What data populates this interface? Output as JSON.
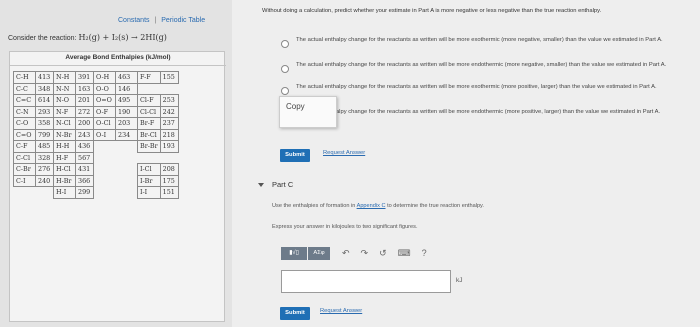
{
  "left": {
    "links": {
      "constants": "Constants",
      "separator": "|",
      "periodic": "Periodic Table"
    },
    "reaction": {
      "prefix": "Consider the reaction:",
      "equation": "H₂(g) + I₂(s) → 2HI(g)"
    },
    "table": {
      "title": "Average Bond Enthalpies (kJ/mol)",
      "rows": [
        [
          "C-H",
          "413",
          "N-H",
          "391",
          "O-H",
          "463",
          "F-F",
          "155"
        ],
        [
          "C-C",
          "348",
          "N-N",
          "163",
          "O-O",
          "146",
          "",
          ""
        ],
        [
          "C=C",
          "614",
          "N-O",
          "201",
          "O=O",
          "495",
          "Cl-F",
          "253"
        ],
        [
          "C-N",
          "293",
          "N-F",
          "272",
          "O-F",
          "190",
          "Cl-Cl",
          "242"
        ],
        [
          "C-O",
          "358",
          "N-Cl",
          "200",
          "O-Cl",
          "203",
          "Br-F",
          "237"
        ],
        [
          "C=O",
          "799",
          "N-Br",
          "243",
          "O-I",
          "234",
          "Br-Cl",
          "218"
        ],
        [
          "C-F",
          "485",
          "H-H",
          "436",
          "",
          "",
          "Br-Br",
          "193"
        ],
        [
          "C-Cl",
          "328",
          "H-F",
          "567",
          "",
          "",
          "",
          ""
        ],
        [
          "C-Br",
          "276",
          "H-Cl",
          "431",
          "",
          "",
          "I-Cl",
          "208"
        ],
        [
          "C-I",
          "240",
          "H-Br",
          "366",
          "",
          "",
          "I-Br",
          "175"
        ],
        [
          "",
          "",
          "H-I",
          "299",
          "",
          "",
          "I-I",
          "151"
        ]
      ]
    }
  },
  "right": {
    "instruction": "Without doing a calculation, predict whether your estimate in Part A is more negative or less negative than the true reaction enthalpy.",
    "options": [
      "The actual enthalpy change for the reactants as written will be more exothermic (more negative, smaller) than the value we estimated in Part A.",
      "The actual enthalpy change for the reactants as written will be more endothermic (more negative, smaller) than the value we estimated in Part A.",
      "The actual enthalpy change for the reactants as written will be more exothermic (more positive, larger) than the value we estimated in Part A.",
      "The actual enthalpy change for the reactants as written will be more endothermic (more positive, larger) than the value we estimated in Part A."
    ],
    "copy_label": "Copy",
    "submit_label": "Submit",
    "request_answer": "Request Answer",
    "part_c": {
      "title": "Part C",
      "instruction_prefix": "Use the enthalpies of formation in",
      "instruction_link": "Appendix C",
      "instruction_suffix": "to determine the true reaction enthalpy.",
      "express": "Express your answer in kilojoules to two significant figures.",
      "toolbar": {
        "templates": "▮√▯",
        "greek": "ΑΣφ",
        "undo": "↶",
        "redo": "↷",
        "reset": "↺",
        "keyboard": "⌨",
        "help": "?"
      },
      "unit": "kJ",
      "submit_label": "Submit",
      "request_answer": "Request Answer"
    }
  }
}
